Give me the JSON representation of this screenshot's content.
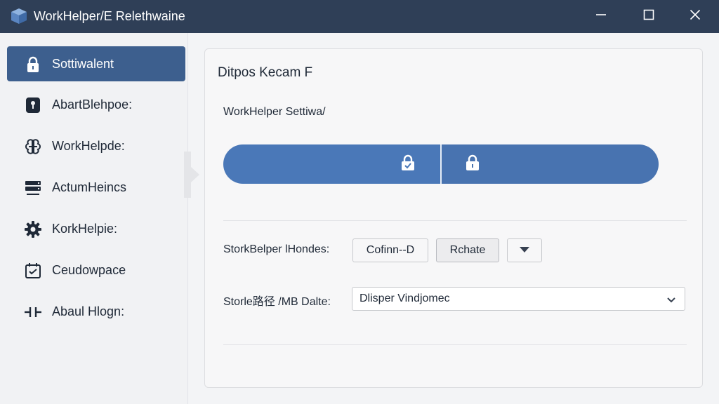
{
  "window": {
    "title": "WorkHelper/E Relethwaine",
    "app_icon": "cube-app-icon",
    "controls": [
      "minimize-icon",
      "maximize-icon",
      "close-icon"
    ]
  },
  "colors": {
    "titlebar": "#2f3f57",
    "accent": "#3d5f8e",
    "segmented": "#4a78b8"
  },
  "sidebar": {
    "items": [
      {
        "label": "Sottiwalent",
        "icon": "lock-icon",
        "active": true
      },
      {
        "label": "AbartBlehpoe:",
        "icon": "keyhole-icon",
        "active": false
      },
      {
        "label": "WorkHelpde:",
        "icon": "brain-icon",
        "active": false
      },
      {
        "label": "ActumHeincs",
        "icon": "server-icon",
        "active": false
      },
      {
        "label": "KorkHelpie:",
        "icon": "gear-icon",
        "active": false
      },
      {
        "label": "Ceudowpace",
        "icon": "calendar-check-icon",
        "active": false
      },
      {
        "label": "Abaul Hlogn:",
        "icon": "connector-icon",
        "active": false
      }
    ]
  },
  "main": {
    "heading": "Ditpos Kecam F",
    "subheading": "WorkHelper Settiwa/",
    "segmented": {
      "left_icon": "lock-check-icon",
      "right_icon": "lock-icon"
    },
    "row1": {
      "label": "StorkBelper lHondes:",
      "button1": "Cofinn--D",
      "button2": "Rchate",
      "dropdown_icon": "caret-down-icon"
    },
    "row2": {
      "label": "Storle路径 /MB Dalte:",
      "value": "Dlisper Vindjomec",
      "dropdown_icon": "chevron-down-icon"
    }
  }
}
